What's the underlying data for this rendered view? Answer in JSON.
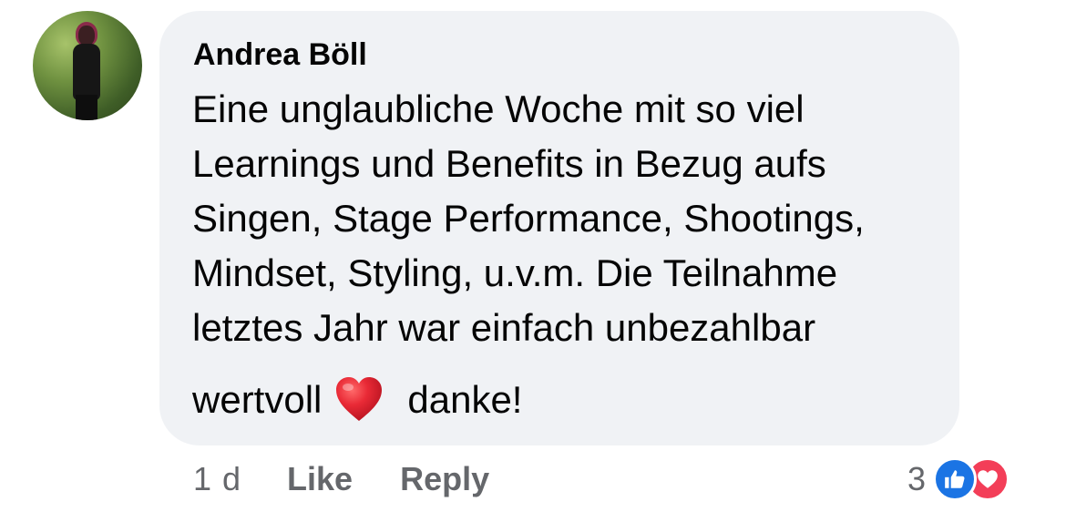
{
  "comment": {
    "author": "Andrea Böll",
    "lines": [
      "Eine unglaubliche Woche mit so viel",
      "Learnings und Benefits in Bezug aufs",
      "Singen, Stage Performance, Shootings,",
      "Mindset, Styling, u.v.m. Die Teilnahme",
      "letztes Jahr war einfach unbezahlbar"
    ],
    "last_line_before_emoji": "wertvoll",
    "emoji": "red-heart-icon",
    "last_line_after_emoji": "danke!"
  },
  "actions": {
    "time": "1 d",
    "like_label": "Like",
    "reply_label": "Reply"
  },
  "reactions": {
    "count": "3",
    "icons": [
      "like-reaction-icon",
      "love-reaction-icon"
    ]
  },
  "colors": {
    "bubble_bg": "#f0f2f5",
    "text": "#050505",
    "secondary_text": "#65676b",
    "like_blue": "#1b74e4",
    "love_red": "#f33e58",
    "heart_emoji": "#e0202f"
  }
}
